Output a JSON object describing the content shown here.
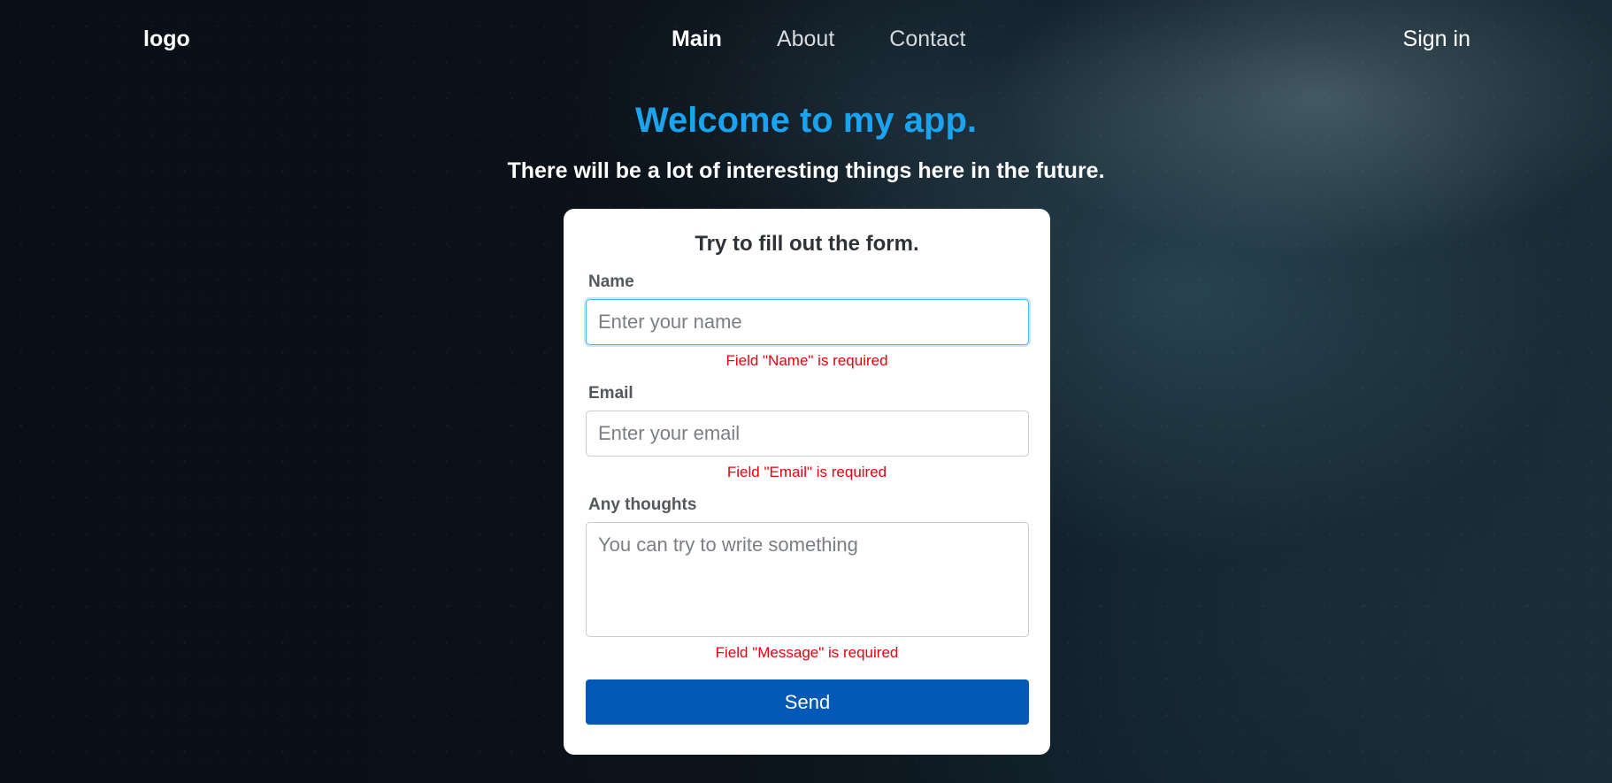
{
  "nav": {
    "logo": "logo",
    "links": [
      {
        "label": "Main",
        "active": true
      },
      {
        "label": "About",
        "active": false
      },
      {
        "label": "Contact",
        "active": false
      }
    ],
    "signin": "Sign in"
  },
  "hero": {
    "title": "Welcome to my app.",
    "subtitle": "There will be a lot of interesting things here in the future."
  },
  "form": {
    "title": "Try to fill out the form.",
    "name": {
      "label": "Name",
      "placeholder": "Enter your name",
      "value": "",
      "error": "Field \"Name\" is required"
    },
    "email": {
      "label": "Email",
      "placeholder": "Enter your email",
      "value": "",
      "error": "Field \"Email\" is required"
    },
    "message": {
      "label": "Any thoughts",
      "placeholder": "You can try to write something",
      "value": "",
      "error": "Field \"Message\" is required"
    },
    "submit_label": "Send"
  },
  "colors": {
    "accent": "#1aa3ee",
    "button": "#0458b8",
    "error": "#e8000d",
    "focus_border": "#54b8ea"
  }
}
